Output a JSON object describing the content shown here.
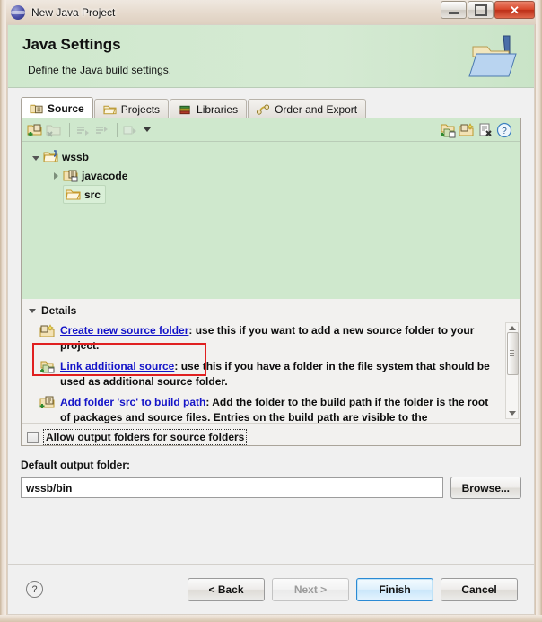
{
  "window": {
    "title": "New Java Project",
    "icon": "java-sphere-icon",
    "controls": {
      "minimize": "minimize-button",
      "maximize": "maximize-button",
      "close": "close-button"
    }
  },
  "banner": {
    "title": "Java Settings",
    "subtitle": "Define the Java build settings.",
    "icon": "java-folder-banner-icon"
  },
  "tabs": [
    {
      "label": "Source",
      "icon": "source-folder-icon",
      "active": true
    },
    {
      "label": "Projects",
      "icon": "projects-folder-icon",
      "active": false
    },
    {
      "label": "Libraries",
      "icon": "libraries-books-icon",
      "active": false
    },
    {
      "label": "Order and Export",
      "icon": "order-export-icon",
      "active": false
    }
  ],
  "tree_toolbar": {
    "left_icons": [
      {
        "name": "add-source-folder-icon",
        "enabled": true
      },
      {
        "name": "remove-source-folder-icon",
        "enabled": false
      },
      {
        "name": "move-up-icon",
        "enabled": false
      },
      {
        "name": "move-down-icon",
        "enabled": false
      },
      {
        "name": "configure-filters-icon",
        "enabled": false
      }
    ],
    "dropdown": "toolbar-dropdown-caret",
    "right_icons": [
      {
        "name": "link-additional-source-icon",
        "enabled": true
      },
      {
        "name": "create-new-source-folder-icon",
        "enabled": true
      },
      {
        "name": "remove-from-build-path-icon",
        "enabled": true
      },
      {
        "name": "help-icon",
        "enabled": true
      }
    ]
  },
  "tree": {
    "nodes": [
      {
        "label": "wssb",
        "icon": "java-project-folder-icon",
        "state": "expanded",
        "indent": 0,
        "selected": false
      },
      {
        "label": "javacode",
        "icon": "source-folder-icon",
        "state": "collapsed",
        "indent": 1,
        "selected": false
      },
      {
        "label": "src",
        "icon": "plain-folder-icon",
        "state": "leaf",
        "indent": 1,
        "selected": true
      }
    ]
  },
  "details": {
    "header": "Details",
    "expanded": true,
    "items": [
      {
        "icon": "create-new-source-folder-icon",
        "link": "Create new source folder",
        "text": ": use this if you want to add a new source folder to your project."
      },
      {
        "icon": "link-additional-source-icon",
        "link": "Link additional source",
        "text": ": use this if you have a folder in the file system that should be used as additional source folder."
      },
      {
        "icon": "add-folder-to-build-path-icon",
        "link": "Add folder 'src' to build path",
        "text": ": Add the folder to the build path if the folder is the root of packages and source files. Entries on the build path are visible to the"
      }
    ],
    "annotation_color": "#e02020"
  },
  "allow_output": {
    "label": "Allow output folders for source folders",
    "checked": false,
    "focused": true
  },
  "output_folder": {
    "label": "Default output folder:",
    "value": "wssb/bin",
    "placeholder": "",
    "browse_label": "Browse..."
  },
  "footer": {
    "help": "?",
    "buttons": [
      {
        "label": "< Back",
        "state": "enabled"
      },
      {
        "label": "Next >",
        "state": "disabled"
      },
      {
        "label": "Finish",
        "state": "default"
      },
      {
        "label": "Cancel",
        "state": "enabled"
      }
    ]
  }
}
